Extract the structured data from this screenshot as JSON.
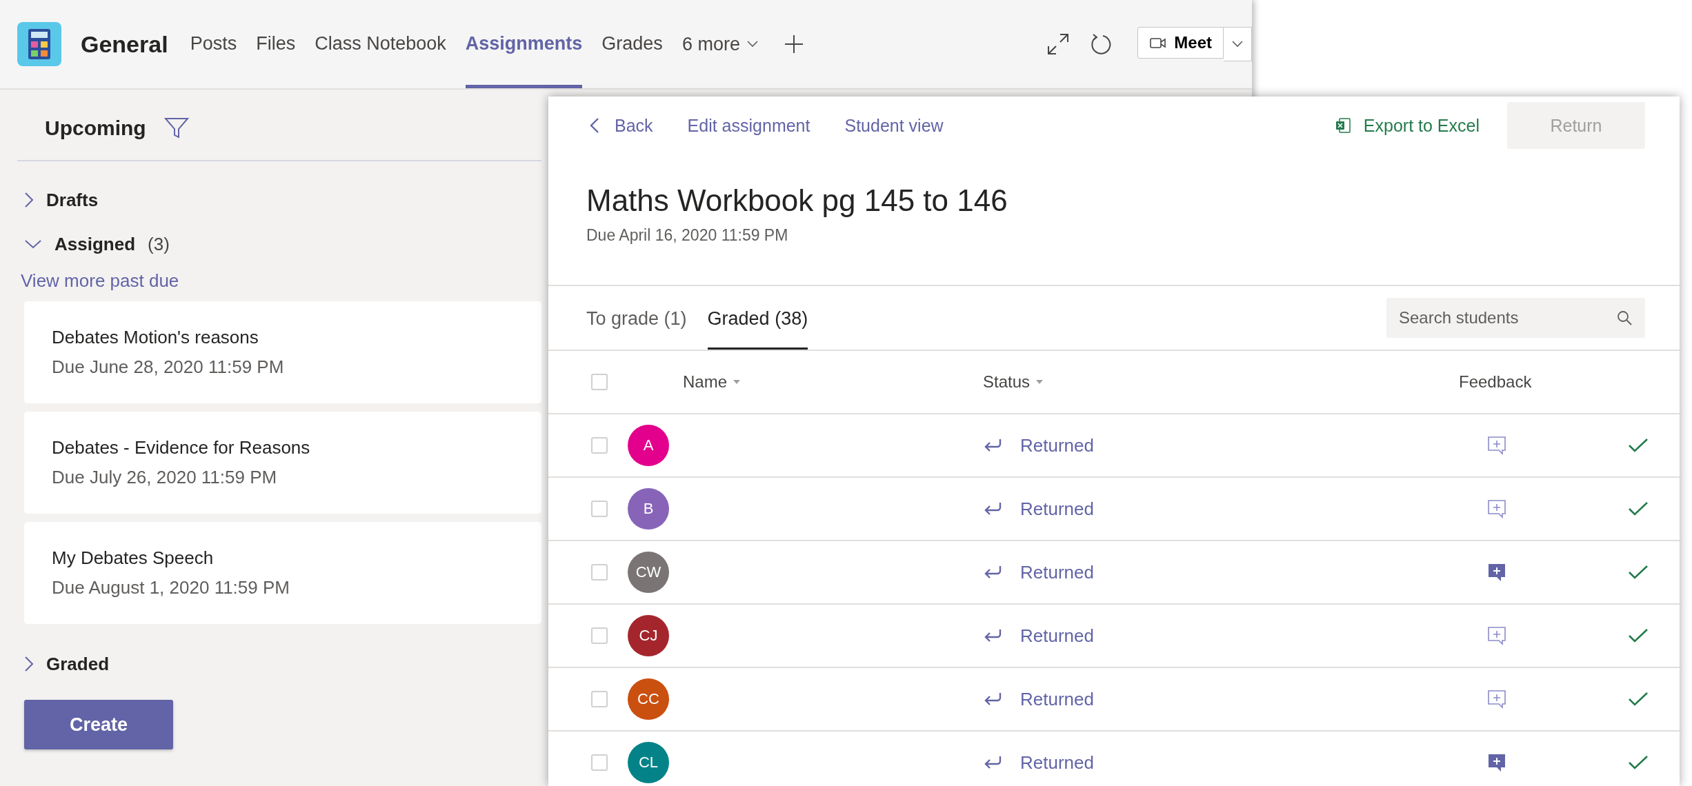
{
  "top_bar": {
    "channel": "General",
    "tabs": [
      {
        "label": "Posts",
        "selected": false
      },
      {
        "label": "Files",
        "selected": false
      },
      {
        "label": "Class Notebook",
        "selected": false
      },
      {
        "label": "Assignments",
        "selected": true
      },
      {
        "label": "Grades",
        "selected": false
      }
    ],
    "more": "6 more",
    "meet": "Meet"
  },
  "sidebar": {
    "heading": "Upcoming",
    "sections": [
      {
        "label": "Drafts",
        "expanded": false
      },
      {
        "label": "Assigned",
        "count": "(3)",
        "expanded": true
      }
    ],
    "past_due_link": "View more past due",
    "assignments": [
      {
        "title": "Debates Motion's reasons",
        "due": "Due June 28, 2020 11:59 PM"
      },
      {
        "title": "Debates - Evidence for Reasons",
        "due": "Due July 26, 2020 11:59 PM"
      },
      {
        "title": "My Debates Speech",
        "due": "Due August 1, 2020 11:59 PM"
      }
    ],
    "graded_section": {
      "label": "Graded",
      "expanded": false
    },
    "create_button": "Create"
  },
  "detail": {
    "toolbar": {
      "back": "Back",
      "edit": "Edit assignment",
      "student_view": "Student view",
      "export": "Export to Excel",
      "return": "Return",
      "return_disabled": true
    },
    "title": "Maths Workbook pg 145 to 146",
    "due": "Due April 16, 2020 11:59 PM",
    "tabs": [
      {
        "label": "To grade (1)",
        "selected": false
      },
      {
        "label": "Graded (38)",
        "selected": true
      }
    ],
    "search": {
      "placeholder": "Search students"
    },
    "select_all_checked": false,
    "table": {
      "columns": [
        "Name",
        "Status",
        "Feedback"
      ],
      "rows": [
        {
          "checked": false,
          "initials": "A",
          "color": "#e3008c",
          "status": "Returned",
          "has_feedback": false
        },
        {
          "checked": false,
          "initials": "B",
          "color": "#8764b8",
          "status": "Returned",
          "has_feedback": false
        },
        {
          "checked": false,
          "initials": "CW",
          "color": "#7a7574",
          "status": "Returned",
          "has_feedback": true
        },
        {
          "checked": false,
          "initials": "CJ",
          "color": "#a4262c",
          "status": "Returned",
          "has_feedback": false
        },
        {
          "checked": false,
          "initials": "CC",
          "color": "#ca5010",
          "status": "Returned",
          "has_feedback": false
        },
        {
          "checked": false,
          "initials": "CL",
          "color": "#038387",
          "status": "Returned",
          "has_feedback": true
        }
      ]
    }
  }
}
